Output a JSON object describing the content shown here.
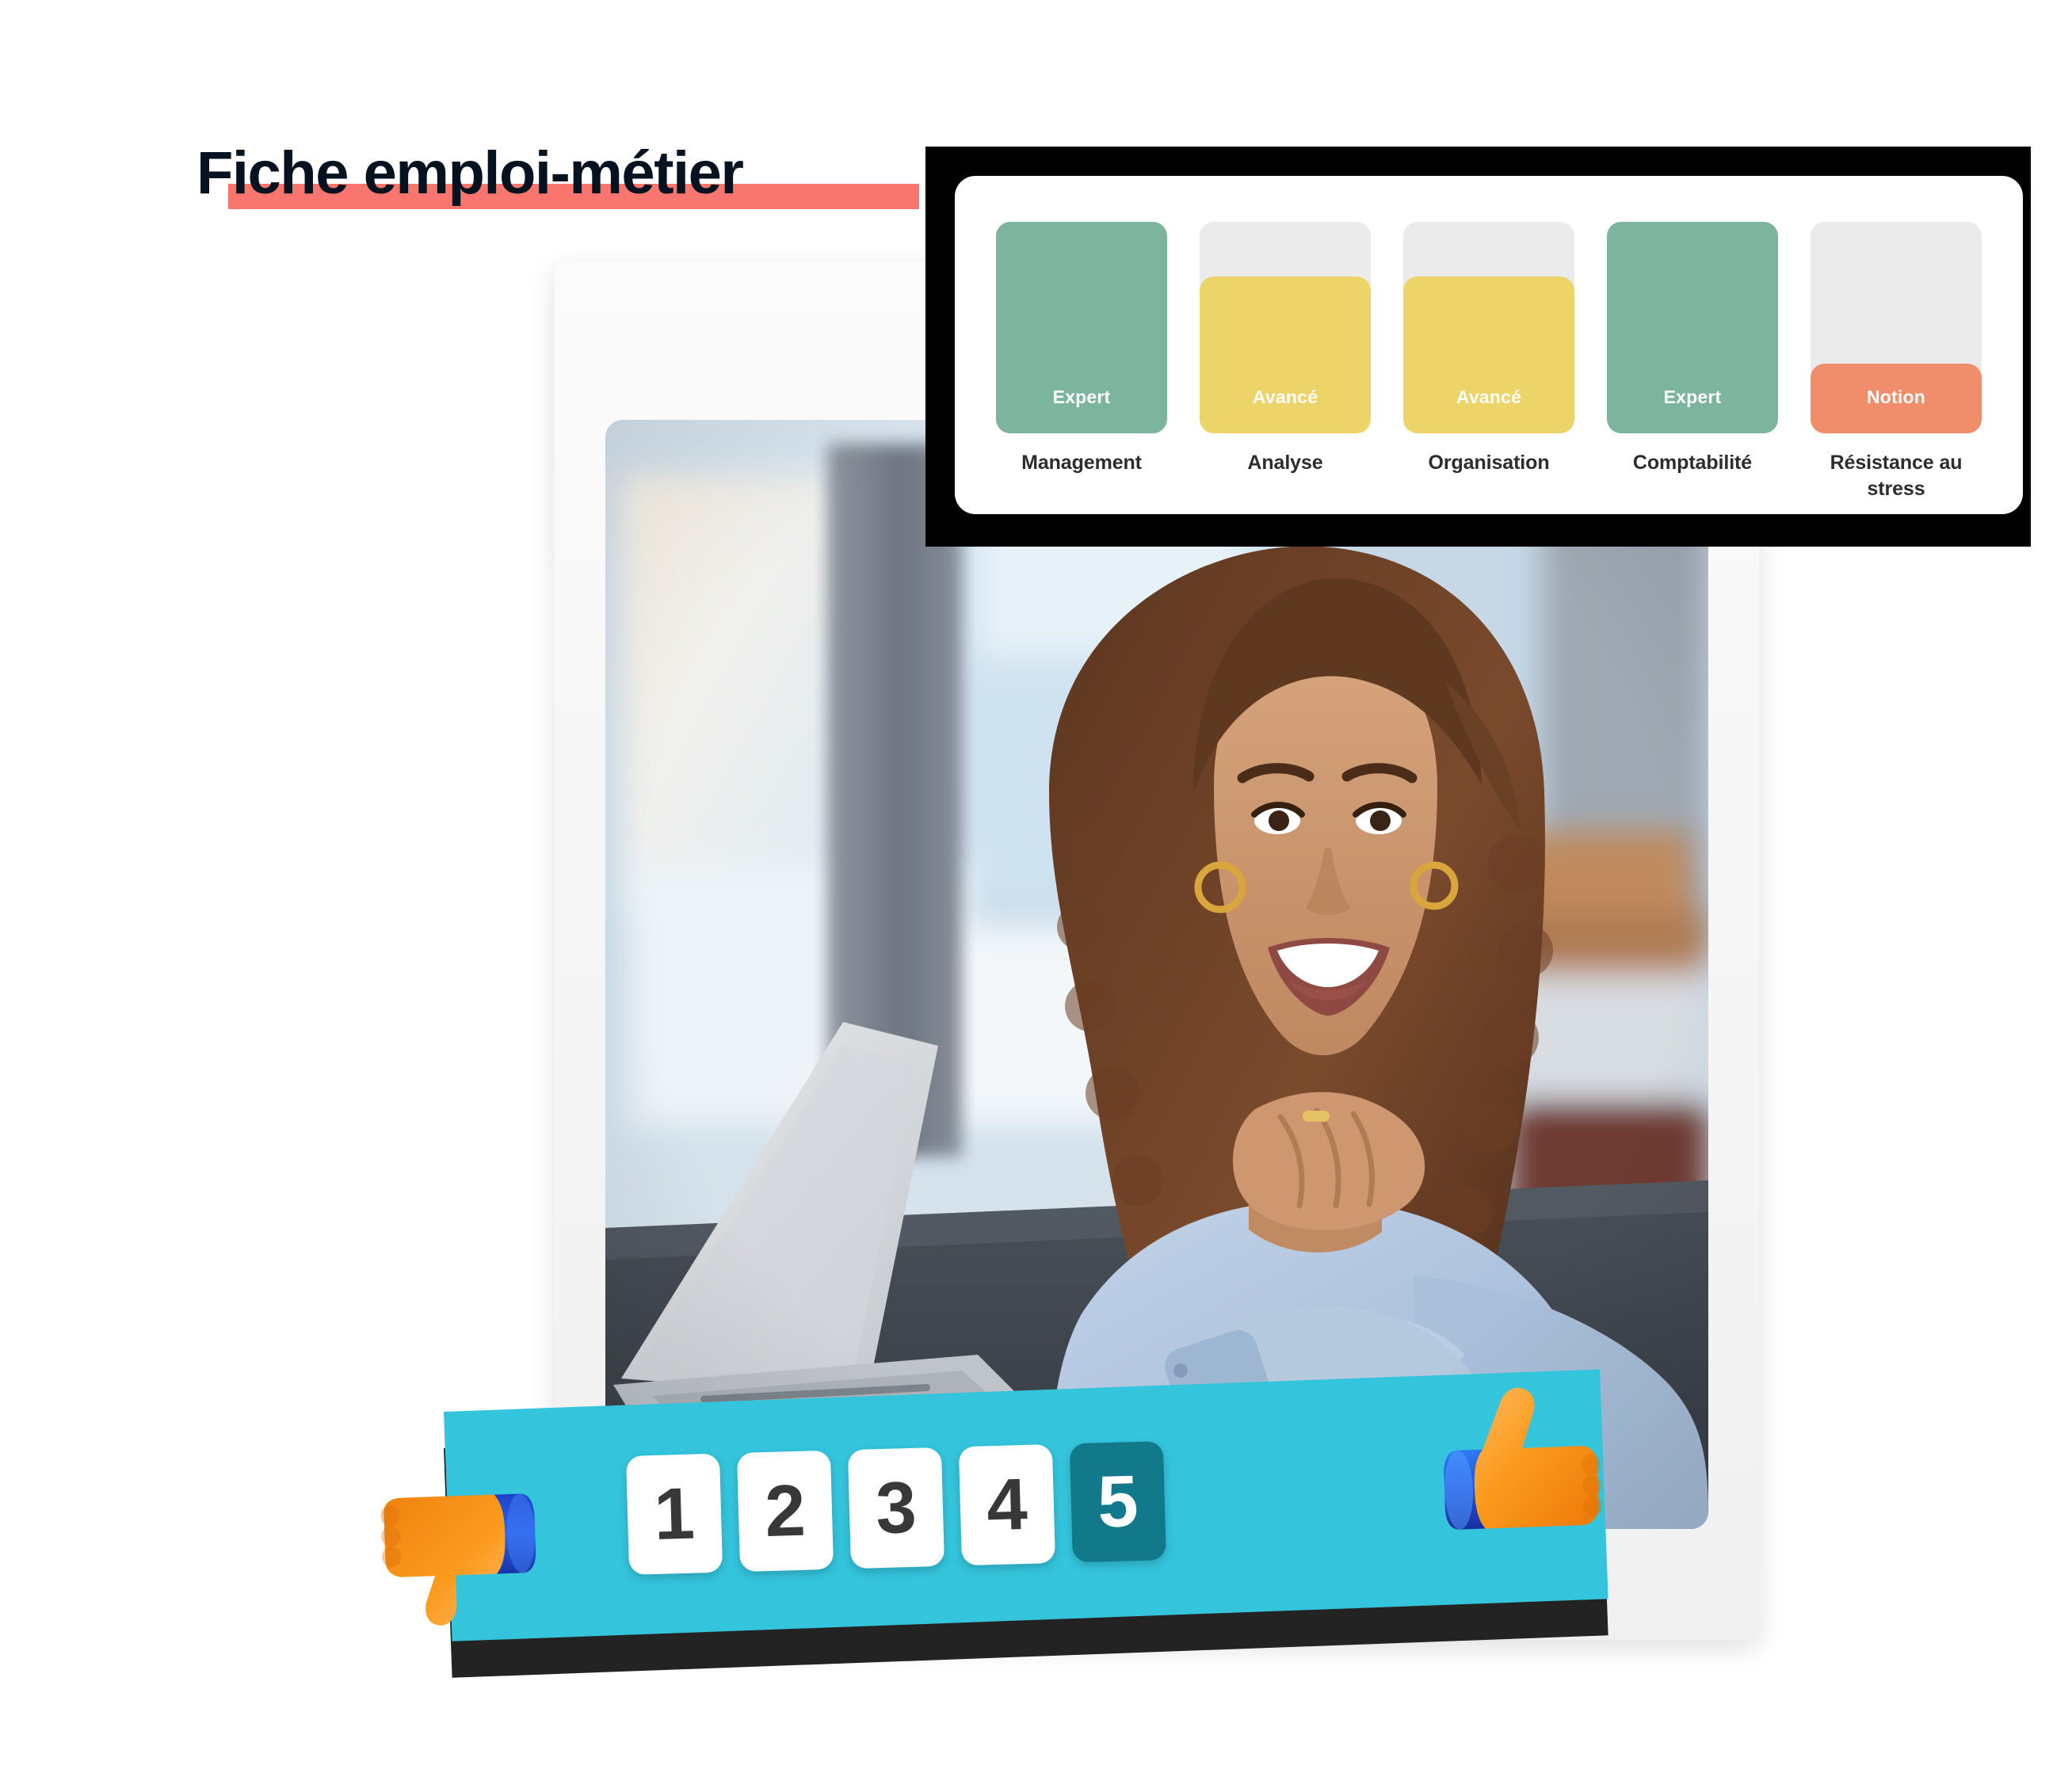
{
  "page": {
    "title": "Fiche emploi-métier",
    "highlight_color": "#F8766E",
    "title_color": "#05121F"
  },
  "photo": {
    "watermark": "",
    "alt": "Femme souriante assise à un bureau devant un ordinateur portable"
  },
  "skills_card": {
    "background": "#FFFFFF",
    "track_color": "#EBEBEB"
  },
  "chart_data": {
    "type": "bar",
    "title": "",
    "xlabel": "",
    "ylabel": "",
    "grid": false,
    "legend": "none",
    "ylim": [
      0,
      100
    ],
    "categories": [
      "Management",
      "Analyse",
      "Organisation",
      "Comptabilité",
      "Résistance au stress"
    ],
    "values": [
      100,
      74,
      74,
      100,
      33
    ],
    "value_labels": [
      "Expert",
      "Avancé",
      "Avancé",
      "Expert",
      "Notion"
    ],
    "colors": [
      "#7DB49D",
      "#EDD468",
      "#EDD468",
      "#7DB49D",
      "#F08D6B"
    ],
    "track_color": "#EBEBEB",
    "label_color": "#2D2D2D",
    "value_label_color": "#FFFFFF"
  },
  "rating": {
    "banner_color": "#34C4DC",
    "selected_color": "#11798A",
    "selected_value": "5",
    "options": [
      {
        "value": "1",
        "selected": false
      },
      {
        "value": "2",
        "selected": false
      },
      {
        "value": "3",
        "selected": false
      },
      {
        "value": "4",
        "selected": false
      },
      {
        "value": "5",
        "selected": true
      }
    ],
    "thumb_down_icon": "thumbs-down-icon",
    "thumb_up_icon": "thumbs-up-icon"
  }
}
